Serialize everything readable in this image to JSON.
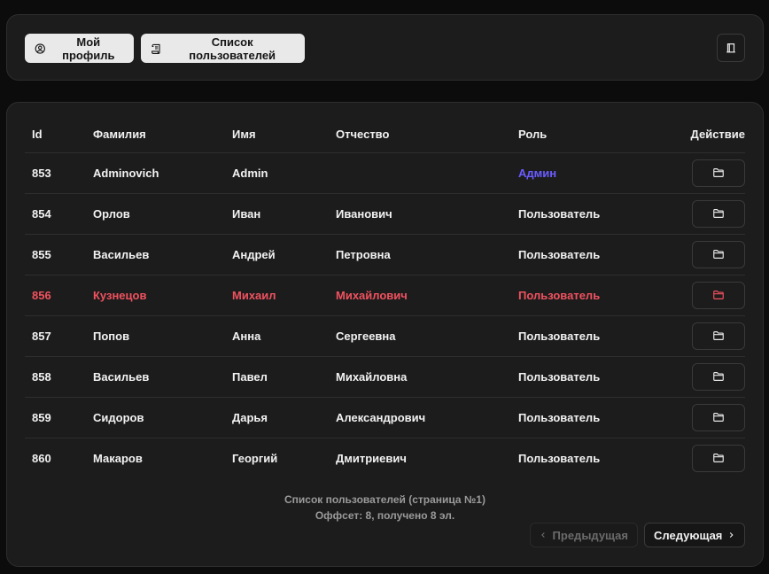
{
  "header": {
    "profile_label": "Мой профиль",
    "users_list_label": "Список пользователей"
  },
  "table": {
    "columns": [
      "Id",
      "Фамилия",
      "Имя",
      "Отчество",
      "Роль",
      "Действие"
    ],
    "rows": [
      {
        "id": "853",
        "last_name": "Adminovich",
        "first_name": "Admin",
        "patronymic": "",
        "role": "Админ"
      },
      {
        "id": "854",
        "last_name": "Орлов",
        "first_name": "Иван",
        "patronymic": "Иванович",
        "role": "Пользователь"
      },
      {
        "id": "855",
        "last_name": "Васильев",
        "first_name": "Андрей",
        "patronymic": "Петровна",
        "role": "Пользователь"
      },
      {
        "id": "856",
        "last_name": "Кузнецов",
        "first_name": "Михаил",
        "patronymic": "Михайлович",
        "role": "Пользователь"
      },
      {
        "id": "857",
        "last_name": "Попов",
        "first_name": "Анна",
        "patronymic": "Сергеевна",
        "role": "Пользователь"
      },
      {
        "id": "858",
        "last_name": "Васильев",
        "first_name": "Павел",
        "patronymic": "Михайловна",
        "role": "Пользователь"
      },
      {
        "id": "859",
        "last_name": "Сидоров",
        "first_name": "Дарья",
        "patronymic": "Александрович",
        "role": "Пользователь"
      },
      {
        "id": "860",
        "last_name": "Макаров",
        "first_name": "Георгий",
        "patronymic": "Дмитриевич",
        "role": "Пользователь"
      }
    ]
  },
  "footer": {
    "page_info": "Список пользователей (страница №1)",
    "offset_info": "Оффсет: 8, получено 8 эл.",
    "prev_label": "Предыдущая",
    "next_label": "Следующая"
  },
  "colors": {
    "background": "#0c0c0c",
    "panel": "#1c1c1c",
    "admin_role": "#6b5cff",
    "highlight_row": "#f0525f"
  },
  "icons": {
    "profile": "user-circle-icon",
    "users_list": "scroll-icon",
    "header_action": "door-icon",
    "row_action": "folder-icon",
    "prev": "chevron-left-icon",
    "next": "chevron-right-icon"
  }
}
